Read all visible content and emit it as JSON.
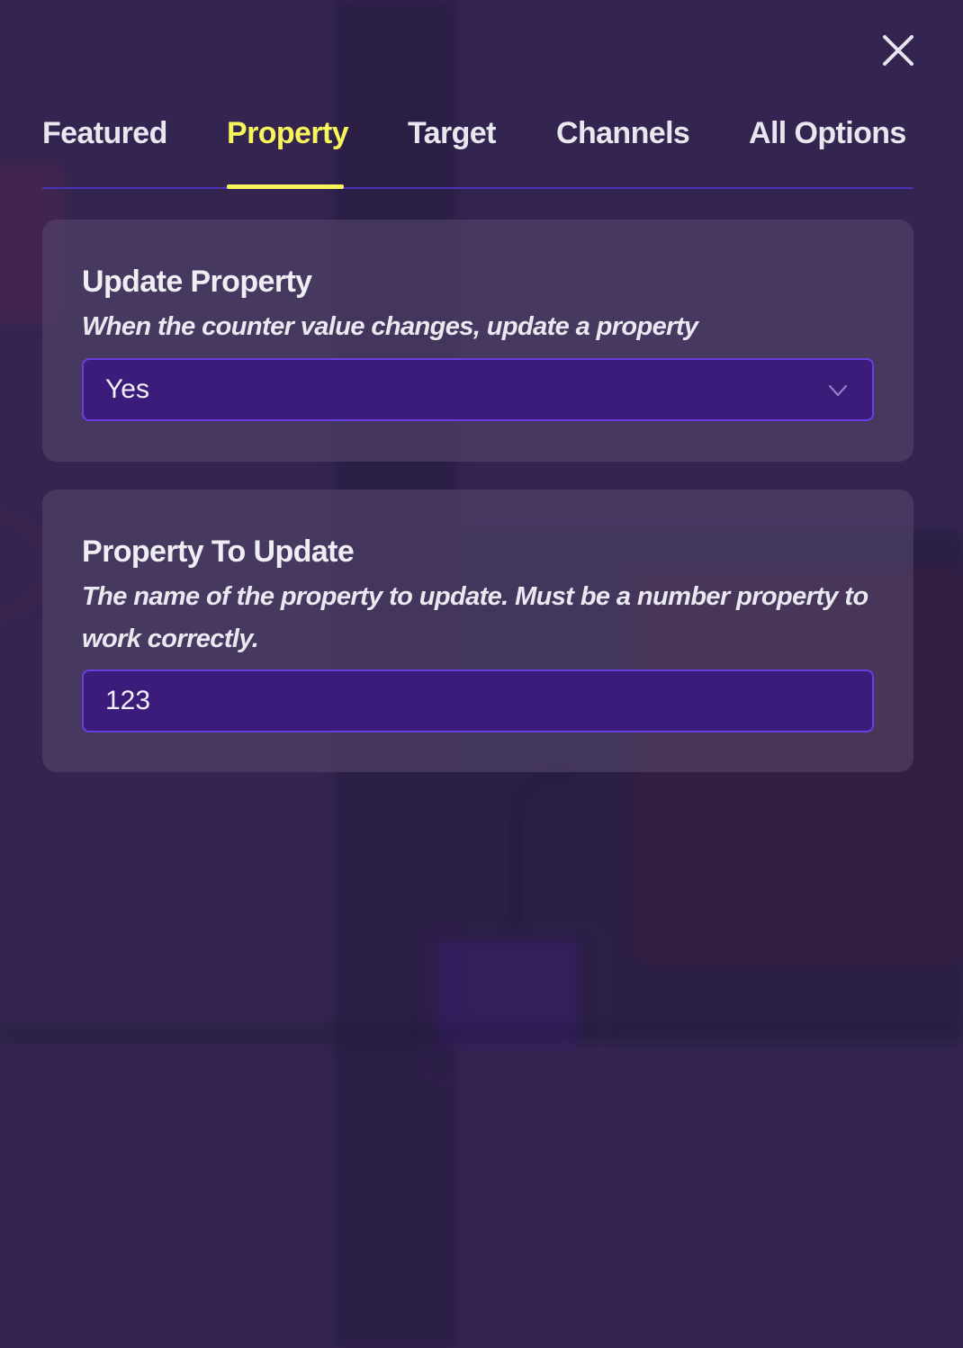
{
  "close": {
    "icon": "close-icon"
  },
  "tabs": [
    {
      "label": "Featured",
      "active": false
    },
    {
      "label": "Property",
      "active": true
    },
    {
      "label": "Target",
      "active": false
    },
    {
      "label": "Channels",
      "active": false
    },
    {
      "label": "All Options",
      "active": false
    }
  ],
  "update_property": {
    "title": "Update Property",
    "description": "When the counter value changes, update a property",
    "selected": "Yes",
    "icon": "chevron-down-icon"
  },
  "property_to_update": {
    "title": "Property To Update",
    "description": "The name of the property to update. Must be a number property to work correctly.",
    "value": "123"
  },
  "colors": {
    "accent": "#f8f55a",
    "field_bg": "#3c1c7a",
    "field_border": "#6a3fe0",
    "tab_underline": "#4a33b8"
  }
}
